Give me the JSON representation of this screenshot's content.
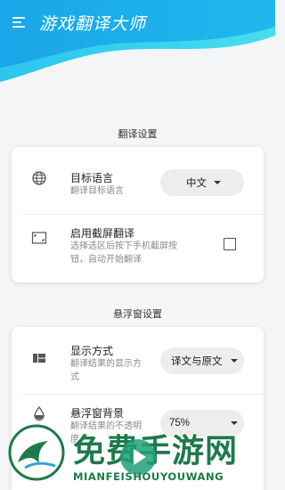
{
  "header": {
    "title": "游戏翻译大师"
  },
  "sections": {
    "translate": {
      "title": "翻译设置",
      "target_language": {
        "label": "目标语言",
        "sub": "翻译目标语言",
        "value": "中文"
      },
      "screenshot": {
        "label": "启用截屏翻译",
        "sub_line1": "选择选区后按下手机截屏按",
        "sub_line2": "钮，自动开始翻译",
        "checked": false
      }
    },
    "float": {
      "title": "悬浮窗设置",
      "display_mode": {
        "label": "显示方式",
        "sub_line1": "翻译结果的显示方",
        "sub_line2": "式",
        "value": "译文与原文"
      },
      "background": {
        "label": "悬浮窗背景",
        "sub_line1": "翻译结果的不透明",
        "sub_line2": "度",
        "value": "75%"
      }
    }
  },
  "watermark": {
    "text": "免费手游网",
    "pinyin": "MIANFEISHOUYOUWANG"
  },
  "colors": {
    "header_blue": "#1aa6e8",
    "header_cyan": "#34d3ef",
    "watermark_green": "#1d7a4a"
  },
  "icons": [
    "menu-icon",
    "globe-icon",
    "crop-icon",
    "layout-icon",
    "opacity-drop-icon",
    "chevron-down-icon",
    "play-icon"
  ]
}
